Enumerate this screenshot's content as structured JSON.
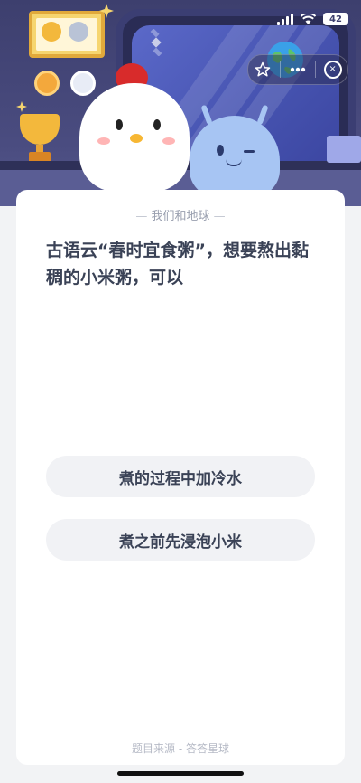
{
  "status_bar": {
    "battery": "42"
  },
  "capsule": {
    "favorite_icon": "star-icon",
    "more_icon": "more-dots-icon",
    "close_icon": "close-circle-icon"
  },
  "hero": {
    "description_icons": [
      "medal-icon",
      "trophy-icon",
      "window-icon",
      "earth-icon",
      "satellite-icon"
    ]
  },
  "quiz": {
    "topic": "我们和地球",
    "question": "古语云“春时宜食粥”，想要熬出黏稠的小米粥，可以",
    "options": [
      {
        "label": "煮的过程中加冷水"
      },
      {
        "label": "煮之前先浸泡小米"
      }
    ],
    "source": "题目来源 - 答答星球"
  },
  "colors": {
    "hero_bg": "#3d3f6e",
    "card_bg": "#ffffff",
    "option_bg": "#f1f2f5",
    "text_primary": "#3a4256",
    "text_muted": "#9aa0b0"
  }
}
